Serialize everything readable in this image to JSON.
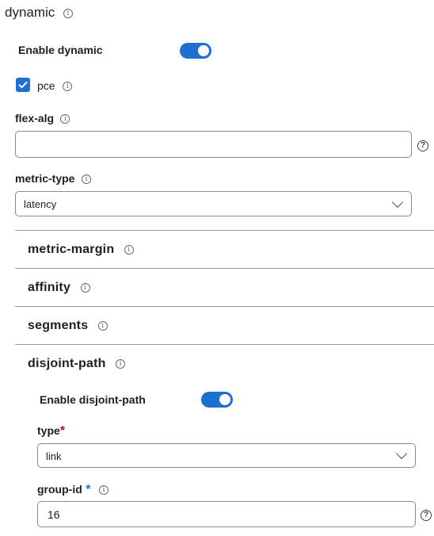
{
  "header": {
    "title": "dynamic"
  },
  "enable_dynamic": {
    "label": "Enable dynamic",
    "on": true
  },
  "pce": {
    "label": "pce",
    "checked": true
  },
  "flex_alg": {
    "label": "flex-alg",
    "value": "",
    "help": "?"
  },
  "metric_type": {
    "label": "metric-type",
    "selected": "latency"
  },
  "sections": {
    "metric_margin": "metric-margin",
    "affinity": "affinity",
    "segments": "segments",
    "disjoint_path": "disjoint-path"
  },
  "disjoint": {
    "enable_label": "Enable disjoint-path",
    "enabled": true,
    "type_label": "type",
    "type_required": "*",
    "type_selected": "link",
    "group_id_label": "group-id",
    "group_id_required": "*",
    "group_id_value": "16",
    "help": "?"
  },
  "icons": {
    "info": "i"
  },
  "colors": {
    "accent": "#1d6fd1",
    "required": "#d0021b"
  }
}
